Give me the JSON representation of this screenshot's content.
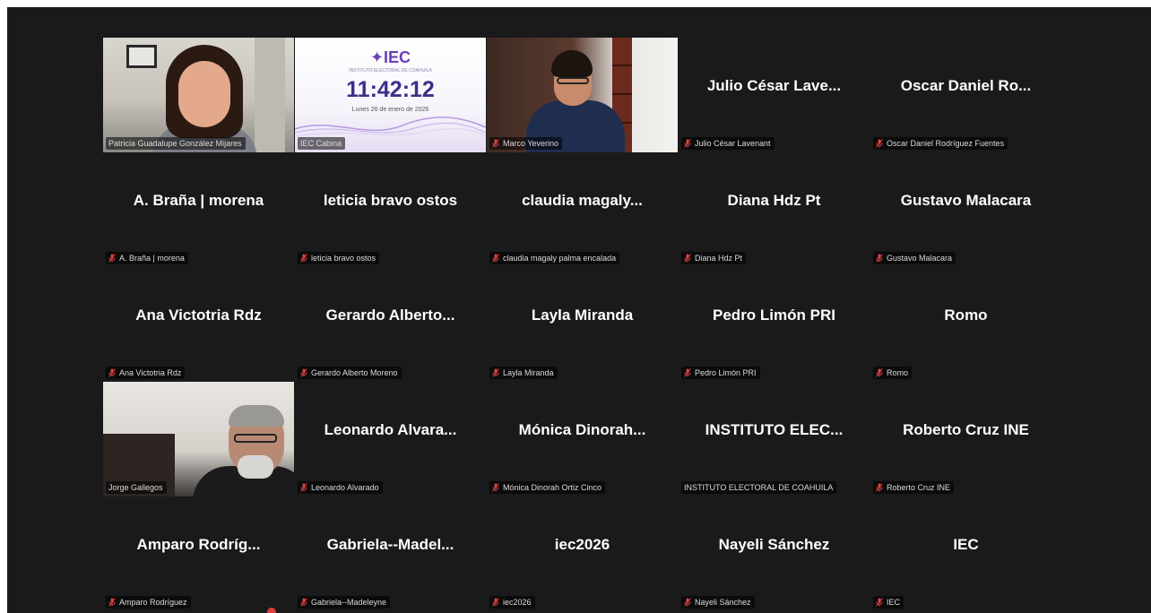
{
  "colors": {
    "background": "#1a1a1a",
    "active_speaker_border": "#34d15a",
    "muted_icon": "#e04040",
    "name_text": "#ffffff"
  },
  "clock_tile": {
    "logo_text": "IEC",
    "logo_sub": "INSTITUTO ELECTORAL DE COAHUILA",
    "time": "11:42:12",
    "date": "Lunes 26 de enero de 2026"
  },
  "participants": [
    {
      "display_name": "",
      "tag": "Patricia Guadalupe González Mijares",
      "muted": false,
      "video": "patricia",
      "active": true
    },
    {
      "display_name": "",
      "tag": "IEC Cabina",
      "muted": false,
      "video": "iec",
      "active": false
    },
    {
      "display_name": "",
      "tag": "Marco Yeverino",
      "muted": true,
      "video": "marco",
      "active": false
    },
    {
      "display_name": "Julio César Lave...",
      "tag": "Julio César Lavenant",
      "muted": true
    },
    {
      "display_name": "Oscar Daniel Ro...",
      "tag": "Oscar Daniel Rodríguez Fuentes",
      "muted": true
    },
    {
      "display_name": "A. Braña | morena",
      "tag": "A. Braña | morena",
      "muted": true
    },
    {
      "display_name": "leticia bravo ostos",
      "tag": "leticia bravo ostos",
      "muted": true
    },
    {
      "display_name": "claudia magaly...",
      "tag": "claudia magaly palma encalada",
      "muted": true
    },
    {
      "display_name": "Diana Hdz Pt",
      "tag": "Diana Hdz Pt",
      "muted": true
    },
    {
      "display_name": "Gustavo Malacara",
      "tag": "Gustavo Malacara",
      "muted": true
    },
    {
      "display_name": "Ana Victotria Rdz",
      "tag": "Ana Victotria Rdz",
      "muted": true
    },
    {
      "display_name": "Gerardo Alberto...",
      "tag": "Gerardo Alberto Moreno",
      "muted": true
    },
    {
      "display_name": "Layla Miranda",
      "tag": "Layla Miranda",
      "muted": true
    },
    {
      "display_name": "Pedro Limón PRI",
      "tag": "Pedro Limón PRI",
      "muted": true
    },
    {
      "display_name": "Romo",
      "tag": "Romo",
      "muted": true
    },
    {
      "display_name": "",
      "tag": "Jorge Gallegos",
      "muted": false,
      "video": "jorge",
      "active": false
    },
    {
      "display_name": "Leonardo Alvara...",
      "tag": "Leonardo Alvarado",
      "muted": true
    },
    {
      "display_name": "Mónica Dinorah...",
      "tag": "Mónica Dinorah Ortiz Cinco",
      "muted": true
    },
    {
      "display_name": "INSTITUTO ELEC...",
      "tag": "INSTITUTO ELECTORAL DE COAHUILA",
      "muted": false
    },
    {
      "display_name": "Roberto Cruz INE",
      "tag": "Roberto Cruz INE",
      "muted": true
    },
    {
      "display_name": "Amparo Rodríg...",
      "tag": "Amparo Rodríguez",
      "muted": true
    },
    {
      "display_name": "Gabriela--Madel...",
      "tag": "Gabriela--Madeleyne",
      "muted": true
    },
    {
      "display_name": "iec2026",
      "tag": "iec2026",
      "muted": true
    },
    {
      "display_name": "Nayeli Sánchez",
      "tag": "Nayeli Sánchez",
      "muted": true
    },
    {
      "display_name": "IEC",
      "tag": "IEC",
      "muted": true
    }
  ]
}
